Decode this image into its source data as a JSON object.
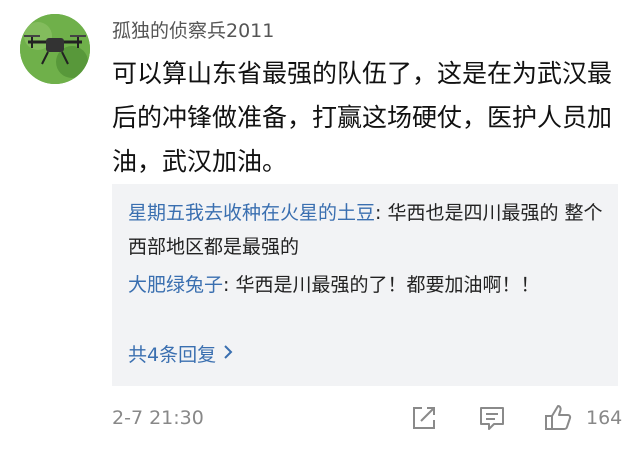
{
  "comment": {
    "username": "孤独的侦察兵2011",
    "text": "可以算山东省最强的队伍了，这是在为武汉最后的冲锋做准备，打赢这场硬仗，医护人员加油，武汉加油。",
    "timestamp": "2-7 21:30",
    "like_count": "164"
  },
  "replies": [
    {
      "author": "星期五我去收种在火星的土豆",
      "separator": ": ",
      "text": "华西也是四川最强的 整个西部地区都是最强的"
    },
    {
      "author": "大肥绿兔子",
      "separator": ": ",
      "text": "华西是川最强的了！都要加油啊！！"
    }
  ],
  "more_replies_label": "共4条回复",
  "icons": {
    "avatar": "drone-avatar",
    "share": "share-icon",
    "reply": "comment-icon",
    "like": "thumbs-up-icon",
    "more": "chevron-right-icon"
  },
  "colors": {
    "link": "#3a6fb0",
    "muted": "#888888",
    "reply_bg": "#f2f3f5"
  }
}
